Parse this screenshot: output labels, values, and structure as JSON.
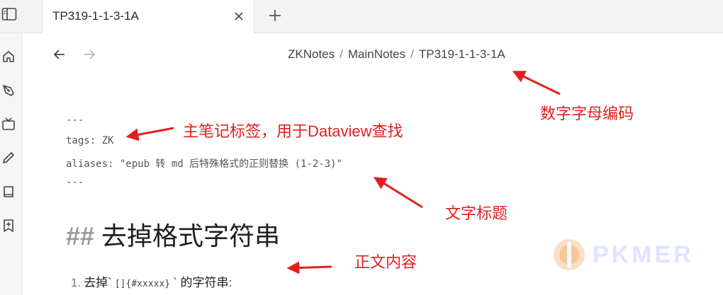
{
  "tabs": [
    {
      "title": "TP319-1-1-3-1A",
      "active": true
    }
  ],
  "breadcrumb": {
    "parts": [
      "ZKNotes",
      "MainNotes",
      "TP319-1-1-3-1A"
    ],
    "separator": "/"
  },
  "frontmatter": {
    "open": "---",
    "tags_line": "tags: ZK",
    "aliases_line": "aliases: \"epub 转 md 后特殊格式的正则替换 (1-2-3)\"",
    "close": "---"
  },
  "content": {
    "heading_marker": "##",
    "heading_text": "去掉格式字符串",
    "list_number": "1.",
    "list_text_before": "去掉`",
    "list_code": "[]{#xxxxx}",
    "list_text_after": "` 的字符串:"
  },
  "annotations": {
    "code_label": "数字字母编码",
    "tag_label": "主笔记标签，用于Dataview查找",
    "title_label": "文字标题",
    "body_label": "正文内容",
    "color": "#e02020"
  },
  "watermark": {
    "text": "PKMER"
  },
  "ribbon_icons": [
    "home-icon",
    "pen-nib-icon",
    "tv-icon",
    "pencil-icon",
    "book-icon",
    "bookmark-plus-icon"
  ]
}
